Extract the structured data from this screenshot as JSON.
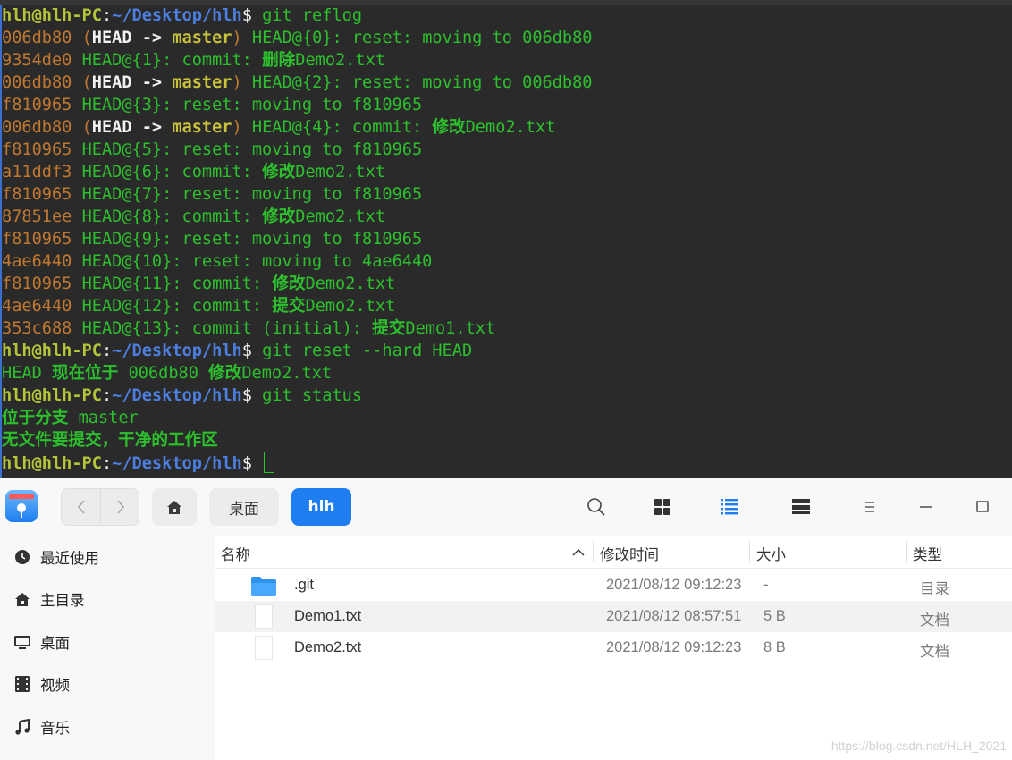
{
  "terminal": {
    "lines": [
      [
        [
          "s-user",
          "hlh@hlh-PC"
        ],
        [
          "s-white",
          ":"
        ],
        [
          "s-path",
          "~/Desktop/hlh"
        ],
        [
          "s-white",
          "$ "
        ],
        [
          "s-green",
          "git reflog"
        ]
      ],
      [
        [
          "s-hash",
          "006db80 "
        ],
        [
          "s-paren",
          "("
        ],
        [
          "s-whiteb",
          "HEAD -> "
        ],
        [
          "s-yellow",
          "master"
        ],
        [
          "s-paren",
          ")"
        ],
        [
          "s-green",
          " HEAD@{0}: reset: moving to 006db80"
        ]
      ],
      [
        [
          "s-hash",
          "9354de0 "
        ],
        [
          "s-green",
          "HEAD@{1}: commit: "
        ],
        [
          "s-cn",
          "删除"
        ],
        [
          "s-green",
          "Demo2.txt"
        ]
      ],
      [
        [
          "s-hash",
          "006db80 "
        ],
        [
          "s-paren",
          "("
        ],
        [
          "s-whiteb",
          "HEAD -> "
        ],
        [
          "s-yellow",
          "master"
        ],
        [
          "s-paren",
          ")"
        ],
        [
          "s-green",
          " HEAD@{2}: reset: moving to 006db80"
        ]
      ],
      [
        [
          "s-hash",
          "f810965 "
        ],
        [
          "s-green",
          "HEAD@{3}: reset: moving to f810965"
        ]
      ],
      [
        [
          "s-hash",
          "006db80 "
        ],
        [
          "s-paren",
          "("
        ],
        [
          "s-whiteb",
          "HEAD -> "
        ],
        [
          "s-yellow",
          "master"
        ],
        [
          "s-paren",
          ")"
        ],
        [
          "s-green",
          " HEAD@{4}: commit: "
        ],
        [
          "s-cn",
          "修改"
        ],
        [
          "s-green",
          "Demo2.txt"
        ]
      ],
      [
        [
          "s-hash",
          "f810965 "
        ],
        [
          "s-green",
          "HEAD@{5}: reset: moving to f810965"
        ]
      ],
      [
        [
          "s-hash",
          "a11ddf3 "
        ],
        [
          "s-green",
          "HEAD@{6}: commit: "
        ],
        [
          "s-cn",
          "修改"
        ],
        [
          "s-green",
          "Demo2.txt"
        ]
      ],
      [
        [
          "s-hash",
          "f810965 "
        ],
        [
          "s-green",
          "HEAD@{7}: reset: moving to f810965"
        ]
      ],
      [
        [
          "s-hash",
          "87851ee "
        ],
        [
          "s-green",
          "HEAD@{8}: commit: "
        ],
        [
          "s-cn",
          "修改"
        ],
        [
          "s-green",
          "Demo2.txt"
        ]
      ],
      [
        [
          "s-hash",
          "f810965 "
        ],
        [
          "s-green",
          "HEAD@{9}: reset: moving to f810965"
        ]
      ],
      [
        [
          "s-hash",
          "4ae6440 "
        ],
        [
          "s-green",
          "HEAD@{10}: reset: moving to 4ae6440"
        ]
      ],
      [
        [
          "s-hash",
          "f810965 "
        ],
        [
          "s-green",
          "HEAD@{11}: commit: "
        ],
        [
          "s-cn",
          "修改"
        ],
        [
          "s-green",
          "Demo2.txt"
        ]
      ],
      [
        [
          "s-hash",
          "4ae6440 "
        ],
        [
          "s-green",
          "HEAD@{12}: commit: "
        ],
        [
          "s-cn",
          "提交"
        ],
        [
          "s-green",
          "Demo2.txt"
        ]
      ],
      [
        [
          "s-hash",
          "353c688 "
        ],
        [
          "s-green",
          "HEAD@{13}: commit (initial): "
        ],
        [
          "s-cn",
          "提交"
        ],
        [
          "s-green",
          "Demo1.txt"
        ]
      ],
      [
        [
          "s-user",
          "hlh@hlh-PC"
        ],
        [
          "s-white",
          ":"
        ],
        [
          "s-path",
          "~/Desktop/hlh"
        ],
        [
          "s-white",
          "$ "
        ],
        [
          "s-green",
          "git reset --hard HEAD"
        ]
      ],
      [
        [
          "s-green",
          "HEAD "
        ],
        [
          "s-cn",
          "现在位于 "
        ],
        [
          "s-green",
          "006db80 "
        ],
        [
          "s-cn",
          "修改"
        ],
        [
          "s-green",
          "Demo2.txt"
        ]
      ],
      [
        [
          "s-user",
          "hlh@hlh-PC"
        ],
        [
          "s-white",
          ":"
        ],
        [
          "s-path",
          "~/Desktop/hlh"
        ],
        [
          "s-white",
          "$ "
        ],
        [
          "s-green",
          "git status"
        ]
      ],
      [
        [
          "s-cn",
          "位于分支 "
        ],
        [
          "s-green",
          "master"
        ]
      ],
      [
        [
          "s-cn",
          "无文件要提交，干净的工作区"
        ]
      ],
      [
        [
          "s-user",
          "hlh@hlh-PC"
        ],
        [
          "s-white",
          ":"
        ],
        [
          "s-path",
          "~/Desktop/hlh"
        ],
        [
          "s-white",
          "$ "
        ]
      ]
    ]
  },
  "toolbar": {
    "back_icon": "chevron-left-icon",
    "forward_icon": "chevron-right-icon",
    "home_icon": "home-icon",
    "breadcrumb": [
      "桌面",
      "hlh"
    ],
    "accent_color": "#1e7df0"
  },
  "sidebar": {
    "items": [
      {
        "label": "最近使用",
        "icon": "clock-icon"
      },
      {
        "label": "主目录",
        "icon": "home-icon"
      },
      {
        "label": "桌面",
        "icon": "desktop-icon"
      },
      {
        "label": "视频",
        "icon": "video-icon"
      },
      {
        "label": "音乐",
        "icon": "music-icon"
      }
    ]
  },
  "list": {
    "columns": [
      "名称",
      "修改时间",
      "大小",
      "类型"
    ],
    "rows": [
      {
        "name": ".git",
        "modified": "2021/08/12 09:12:23",
        "size": "-",
        "type": "目录",
        "icon": "folder-icon"
      },
      {
        "name": "Demo1.txt",
        "modified": "2021/08/12 08:57:51",
        "size": "5 B",
        "type": "文档",
        "icon": "file-icon"
      },
      {
        "name": "Demo2.txt",
        "modified": "2021/08/12 09:12:23",
        "size": "8 B",
        "type": "文档",
        "icon": "file-icon"
      }
    ]
  },
  "watermark": "https://blog.csdn.net/HLH_2021"
}
